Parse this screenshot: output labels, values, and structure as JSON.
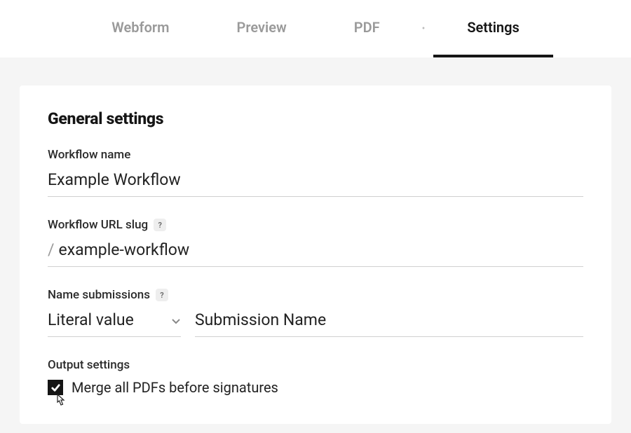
{
  "tabs": {
    "items": [
      {
        "label": "Webform"
      },
      {
        "label": "Preview"
      },
      {
        "label": "PDF"
      },
      {
        "label": "Settings"
      }
    ],
    "separator": "•",
    "active_index": 3
  },
  "section": {
    "title": "General settings"
  },
  "fields": {
    "workflow_name": {
      "label": "Workflow name",
      "value": "Example Workflow"
    },
    "workflow_slug": {
      "label": "Workflow URL slug",
      "prefix": "/",
      "value": "example-workflow",
      "help": "?"
    },
    "name_submissions": {
      "label": "Name submissions",
      "help": "?",
      "select_value": "Literal value",
      "input_value": "Submission Name"
    }
  },
  "output": {
    "title": "Output settings",
    "merge_checkbox": {
      "label": "Merge all PDFs before signatures",
      "checked": true
    }
  }
}
